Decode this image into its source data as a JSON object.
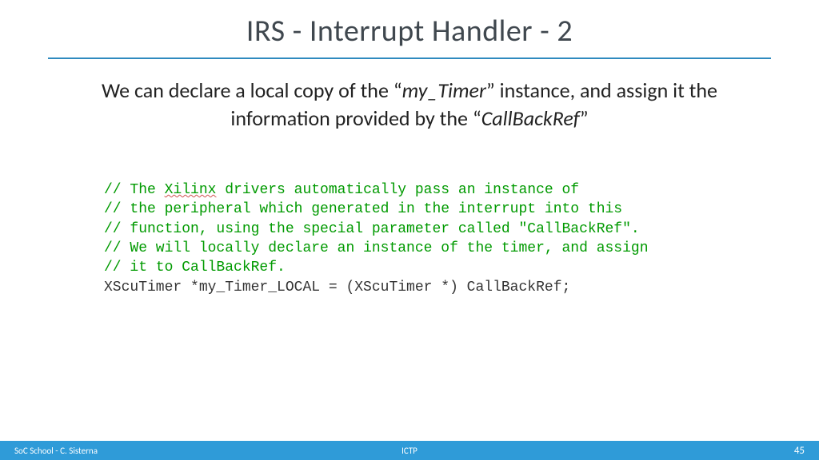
{
  "title": "IRS - Interrupt Handler - 2",
  "body": {
    "line1_a": "We can declare a local copy of the “",
    "line1_it1": "my_Timer",
    "line1_b": "” instance, and assign it the",
    "line2_a": "information provided by the “",
    "line2_it1": "CallBackRef",
    "line2_b": "”"
  },
  "code": {
    "c1a": "// The ",
    "c1_squiggle": "Xilinx",
    "c1b": " drivers automatically pass an instance of",
    "c2": "// the peripheral which generated in the interrupt into this",
    "c3": "// function, using the special parameter called \"CallBackRef\".",
    "c4": "// We will locally declare an instance of the timer, and assign",
    "c5": "// it to CallBackRef.",
    "stmt": "XScuTimer *my_Timer_LOCAL = (XScuTimer *) CallBackRef;"
  },
  "footer": {
    "left": "SoC School - C. Sisterna",
    "center": "ICTP",
    "right": "45"
  }
}
